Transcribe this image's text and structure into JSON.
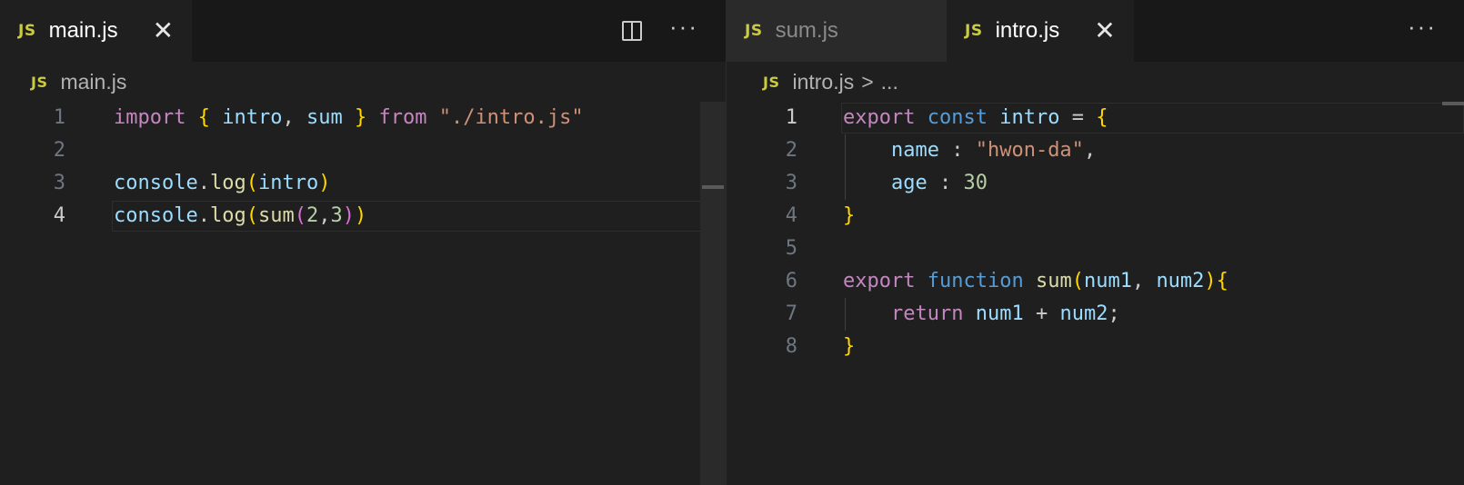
{
  "left_pane": {
    "tabs": [
      {
        "badge": "JS",
        "label": "main.js",
        "close": "✕",
        "active": true
      }
    ],
    "breadcrumb": {
      "badge": "JS",
      "file": "main.js"
    },
    "actions": {
      "split_title": "Split Editor",
      "more": "···"
    },
    "lines": [
      {
        "n": "1",
        "tokens": [
          [
            "import",
            "kw"
          ],
          [
            " ",
            "punc"
          ],
          [
            "{",
            "brace"
          ],
          [
            " ",
            "punc"
          ],
          [
            "intro",
            "var"
          ],
          [
            ", ",
            "punc"
          ],
          [
            "sum",
            "var"
          ],
          [
            " ",
            "punc"
          ],
          [
            "}",
            "brace"
          ],
          [
            " ",
            "punc"
          ],
          [
            "from",
            "kw"
          ],
          [
            " ",
            "punc"
          ],
          [
            "\"./intro.js\"",
            "str"
          ]
        ]
      },
      {
        "n": "2",
        "tokens": []
      },
      {
        "n": "3",
        "tokens": [
          [
            "console",
            "var"
          ],
          [
            ".",
            "punc"
          ],
          [
            "log",
            "fn"
          ],
          [
            "(",
            "brace"
          ],
          [
            "intro",
            "var"
          ],
          [
            ")",
            "brace"
          ]
        ]
      },
      {
        "n": "4",
        "current": true,
        "tokens": [
          [
            "console",
            "var"
          ],
          [
            ".",
            "punc"
          ],
          [
            "log",
            "fn"
          ],
          [
            "(",
            "brace"
          ],
          [
            "sum",
            "fn"
          ],
          [
            "(",
            "brace2"
          ],
          [
            "2",
            "num"
          ],
          [
            ",",
            "punc"
          ],
          [
            "3",
            "num"
          ],
          [
            ")",
            "brace2"
          ],
          [
            ")",
            "brace"
          ]
        ]
      }
    ]
  },
  "right_pane": {
    "tabs": [
      {
        "badge": "JS",
        "label": "sum.js",
        "active": false
      },
      {
        "badge": "JS",
        "label": "intro.js",
        "close": "✕",
        "active": true
      }
    ],
    "breadcrumb": {
      "badge": "JS",
      "file": "intro.js",
      "separator": ">",
      "rest": "..."
    },
    "actions": {
      "more": "···"
    },
    "lines": [
      {
        "n": "1",
        "current": true,
        "tokens": [
          [
            "export",
            "kw"
          ],
          [
            " ",
            "punc"
          ],
          [
            "const",
            "kw2"
          ],
          [
            " ",
            "punc"
          ],
          [
            "intro",
            "var"
          ],
          [
            " = ",
            "punc"
          ],
          [
            "{",
            "brace"
          ]
        ]
      },
      {
        "n": "2",
        "tokens": [
          [
            "    ",
            "punc"
          ],
          [
            "name",
            "var"
          ],
          [
            " : ",
            "punc"
          ],
          [
            "\"hwon-da\"",
            "str"
          ],
          [
            ",",
            "punc"
          ]
        ]
      },
      {
        "n": "3",
        "tokens": [
          [
            "    ",
            "punc"
          ],
          [
            "age",
            "var"
          ],
          [
            " : ",
            "punc"
          ],
          [
            "30",
            "num"
          ]
        ]
      },
      {
        "n": "4",
        "tokens": [
          [
            "}",
            "brace"
          ]
        ]
      },
      {
        "n": "5",
        "tokens": []
      },
      {
        "n": "6",
        "tokens": [
          [
            "export",
            "kw"
          ],
          [
            " ",
            "punc"
          ],
          [
            "function",
            "kw2"
          ],
          [
            " ",
            "punc"
          ],
          [
            "sum",
            "fn"
          ],
          [
            "(",
            "brace"
          ],
          [
            "num1",
            "var"
          ],
          [
            ", ",
            "punc"
          ],
          [
            "num2",
            "var"
          ],
          [
            ")",
            "brace"
          ],
          [
            "{",
            "brace"
          ]
        ]
      },
      {
        "n": "7",
        "tokens": [
          [
            "    ",
            "punc"
          ],
          [
            "return",
            "kw"
          ],
          [
            " ",
            "punc"
          ],
          [
            "num1",
            "var"
          ],
          [
            " + ",
            "punc"
          ],
          [
            "num2",
            "var"
          ],
          [
            ";",
            "punc"
          ]
        ]
      },
      {
        "n": "8",
        "tokens": [
          [
            "}",
            "brace"
          ]
        ]
      }
    ]
  }
}
